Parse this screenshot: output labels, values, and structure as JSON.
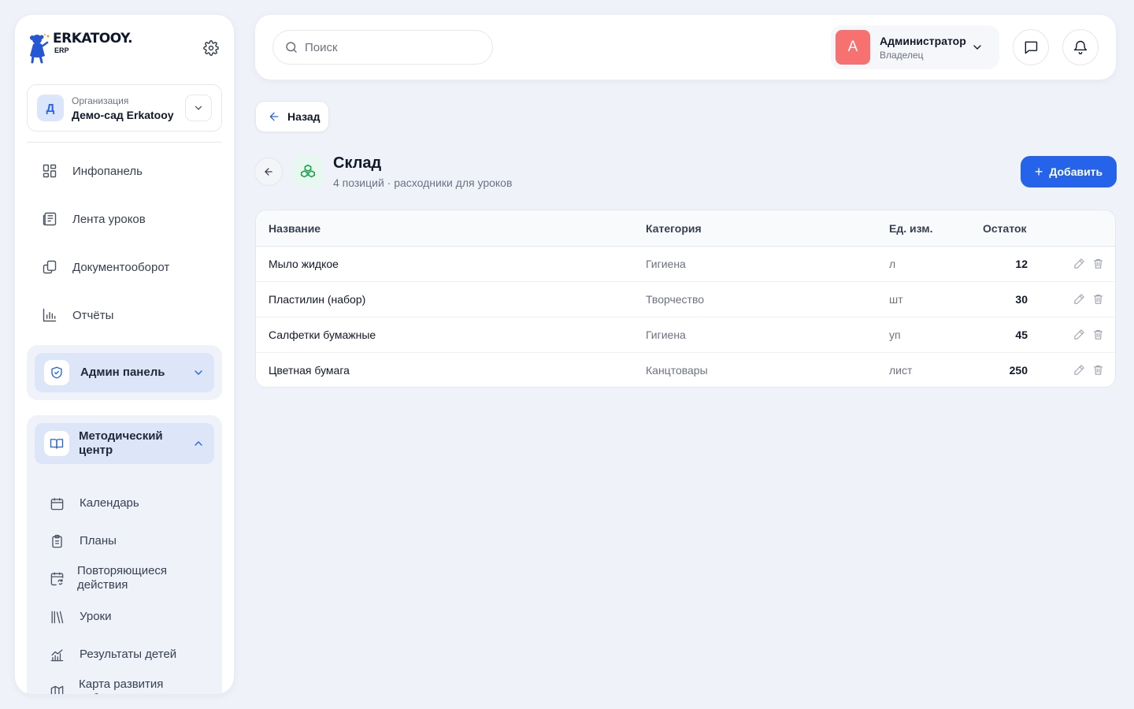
{
  "brand": {
    "name": "ERKATOOY.",
    "sub": "ERP"
  },
  "org": {
    "avatar": "Д",
    "label": "Организация",
    "name": "Демо-сад Erkatooy"
  },
  "nav": [
    {
      "label": "Инфопанель",
      "icon": "dashboard-icon"
    },
    {
      "label": "Лента уроков",
      "icon": "news-icon"
    },
    {
      "label": "Документооборот",
      "icon": "documents-icon"
    },
    {
      "label": "Отчёты",
      "icon": "chart-icon"
    }
  ],
  "admin_group": {
    "label": "Админ панель",
    "icon": "shield-check-icon"
  },
  "method_group": {
    "label": "Методический центр",
    "icon": "book-icon",
    "items": [
      {
        "label": "Календарь",
        "icon": "calendar-icon"
      },
      {
        "label": "Планы",
        "icon": "clipboard-icon"
      },
      {
        "label": "Повторяющиеся действия",
        "icon": "calendar-repeat-icon"
      },
      {
        "label": "Уроки",
        "icon": "library-icon"
      },
      {
        "label": "Результаты детей",
        "icon": "trend-chart-icon"
      },
      {
        "label": "Карта развития ребенка",
        "icon": "map-icon"
      }
    ]
  },
  "header": {
    "search_placeholder": "Поиск",
    "user": {
      "avatar": "А",
      "name": "Администратор",
      "role": "Владелец"
    }
  },
  "back_label": "Назад",
  "page": {
    "title": "Склад",
    "subtitle": "4 позиций · расходники для уроков",
    "add_label": "Добавить"
  },
  "table": {
    "columns": [
      "Название",
      "Категория",
      "Ед. изм.",
      "Остаток"
    ],
    "rows": [
      {
        "name": "Мыло жидкое",
        "category": "Гигиена",
        "unit": "л",
        "qty": "12"
      },
      {
        "name": "Пластилин (набор)",
        "category": "Творчество",
        "unit": "шт",
        "qty": "30"
      },
      {
        "name": "Салфетки бумажные",
        "category": "Гигиена",
        "unit": "уп",
        "qty": "45"
      },
      {
        "name": "Цветная бумага",
        "category": "Канцтовары",
        "unit": "лист",
        "qty": "250"
      }
    ]
  },
  "colors": {
    "accent": "#2563eb",
    "avatar": "#f87171",
    "sidebar_active": "#dde6f8",
    "background": "#eff2f9"
  }
}
